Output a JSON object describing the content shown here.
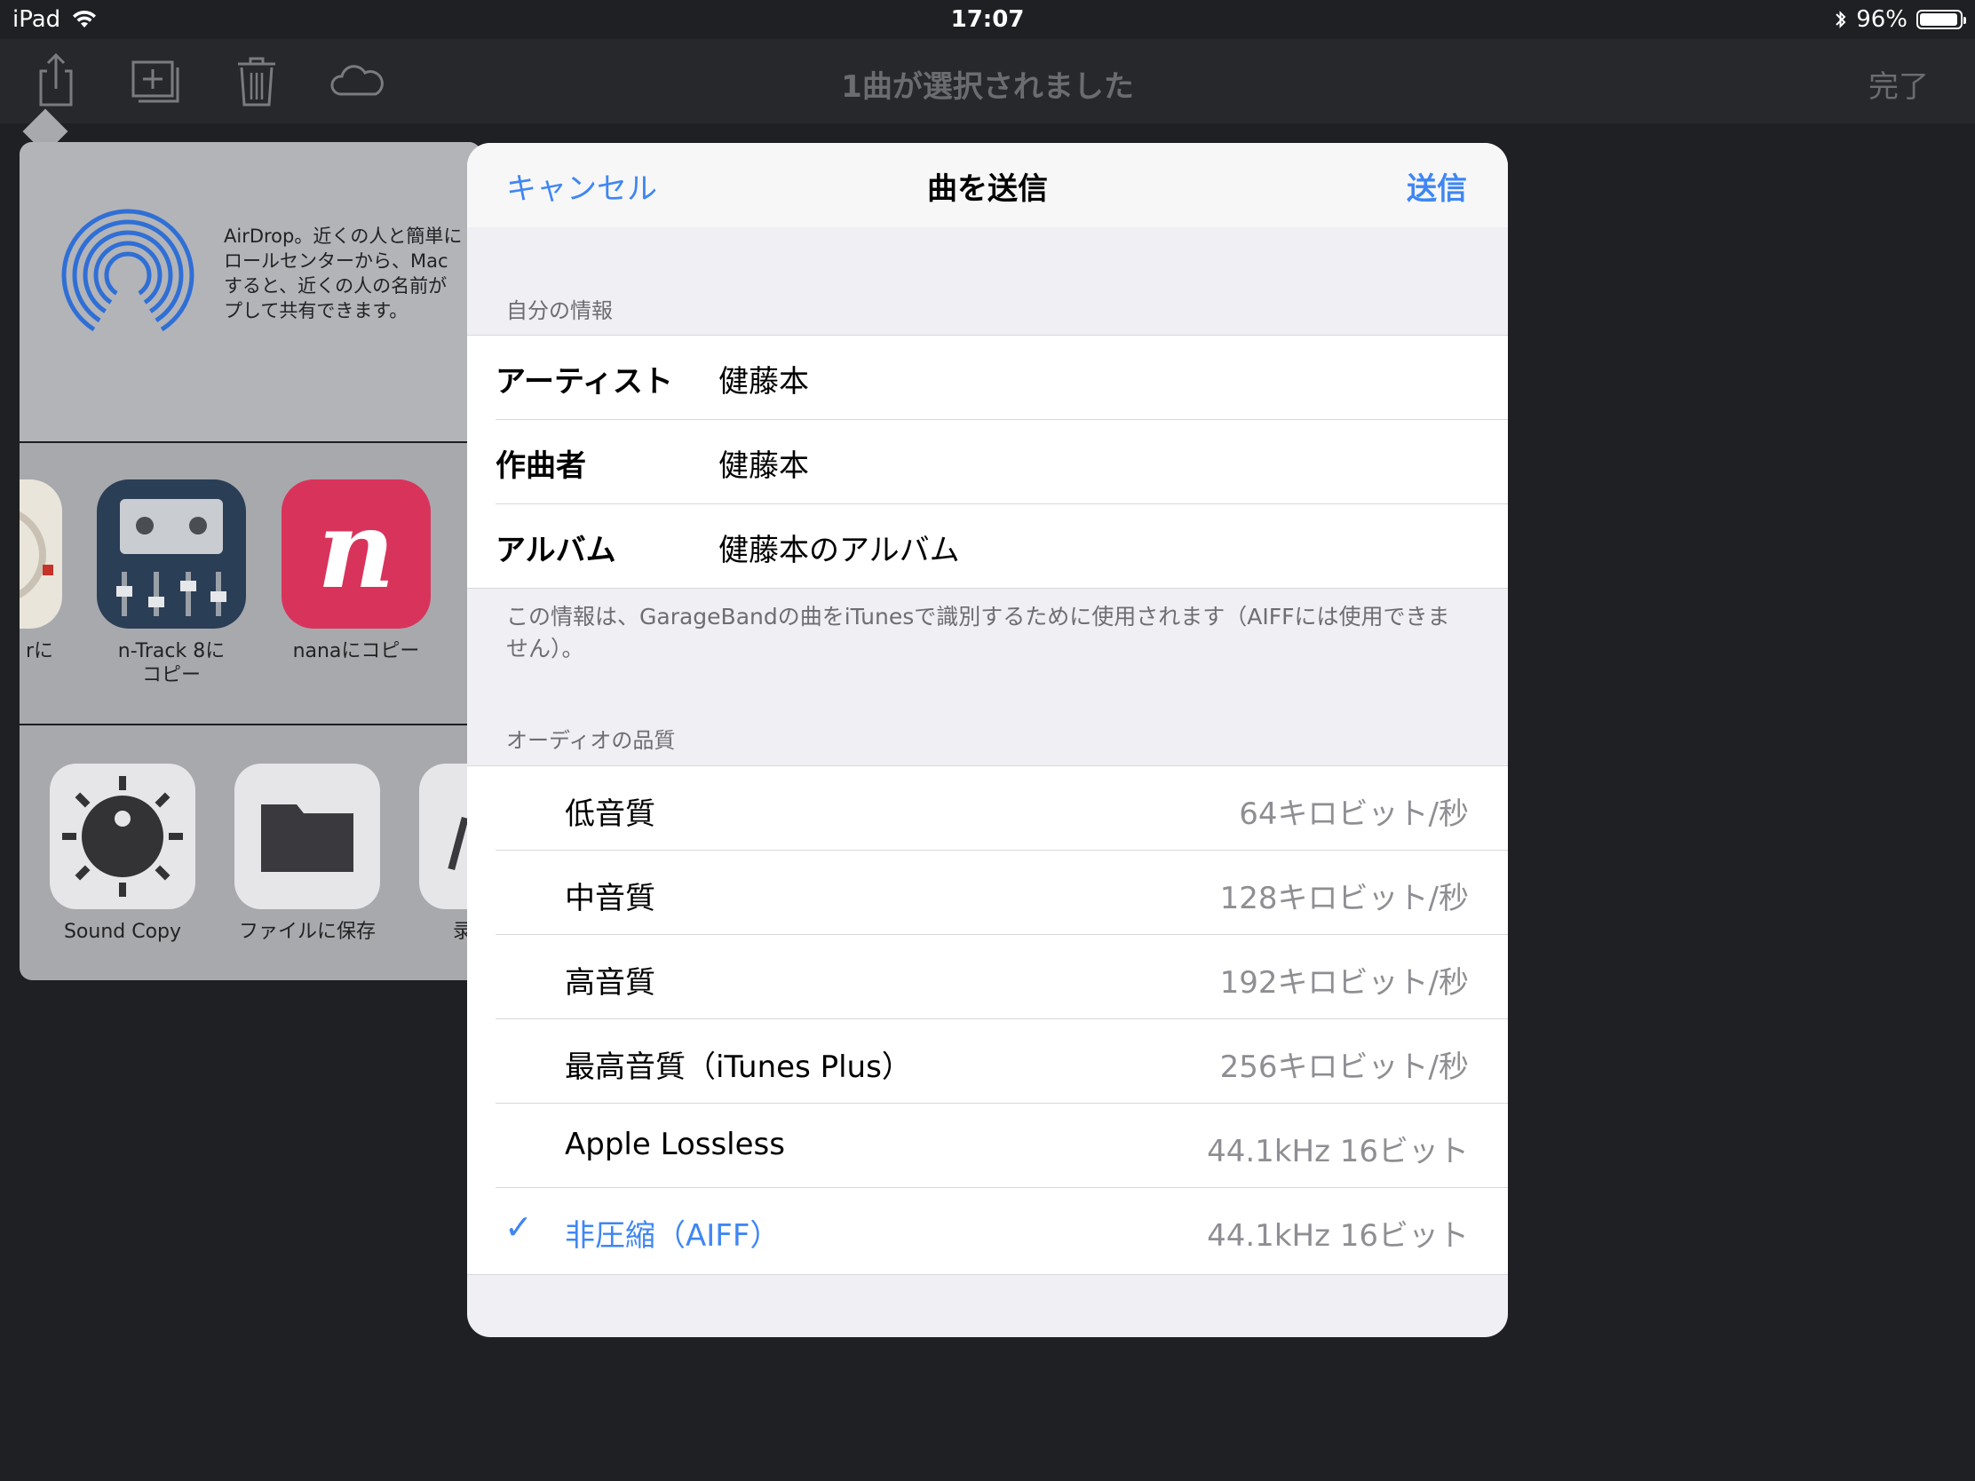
{
  "status_bar": {
    "device": "iPad",
    "time": "17:07",
    "battery": "96%",
    "battery_level": 0.96
  },
  "toolbar": {
    "title": "1曲が選択されました",
    "done": "完了",
    "icons": [
      "share-icon",
      "add-to-icon",
      "trash-icon",
      "cloud-icon"
    ]
  },
  "share_sheet": {
    "airdrop_text": "AirDrop。近くの人と簡単に\nロールセンターから、Mac\nすると、近くの人の名前が\nプして共有できます。",
    "apps": [
      {
        "label": "rに"
      },
      {
        "label": "n-Track 8に\nコピー"
      },
      {
        "label": "nanaにコピー"
      }
    ],
    "actions": [
      {
        "label": "Sound Copy"
      },
      {
        "label": "ファイルに保存"
      },
      {
        "label": "录"
      }
    ]
  },
  "dialog": {
    "cancel": "キャンセル",
    "title": "曲を送信",
    "send": "送信",
    "my_info_header": "自分の情報",
    "fields": [
      {
        "label": "アーティスト",
        "value": "健藤本"
      },
      {
        "label": "作曲者",
        "value": "健藤本"
      },
      {
        "label": "アルバム",
        "value": "健藤本のアルバム"
      }
    ],
    "note": "この情報は、GarageBandの曲をiTunesで識別するために使用されます（AIFFには使用できません）。",
    "quality_header": "オーディオの品質",
    "quality_options": [
      {
        "label": "低音質",
        "value": "64キロビット/秒",
        "selected": false
      },
      {
        "label": "中音質",
        "value": "128キロビット/秒",
        "selected": false
      },
      {
        "label": "高音質",
        "value": "192キロビット/秒",
        "selected": false
      },
      {
        "label": "最高音質（iTunes Plus）",
        "value": "256キロビット/秒",
        "selected": false
      },
      {
        "label": "Apple Lossless",
        "value": "44.1kHz 16ビット",
        "selected": false
      },
      {
        "label": "非圧縮（AIFF）",
        "value": "44.1kHz 16ビット",
        "selected": true
      }
    ],
    "check_mark": "✓"
  },
  "colors": {
    "accent": "#3f86f4",
    "background": "#1f2023",
    "toolbar": "#27282b",
    "dialog_bg": "#efeff4"
  }
}
